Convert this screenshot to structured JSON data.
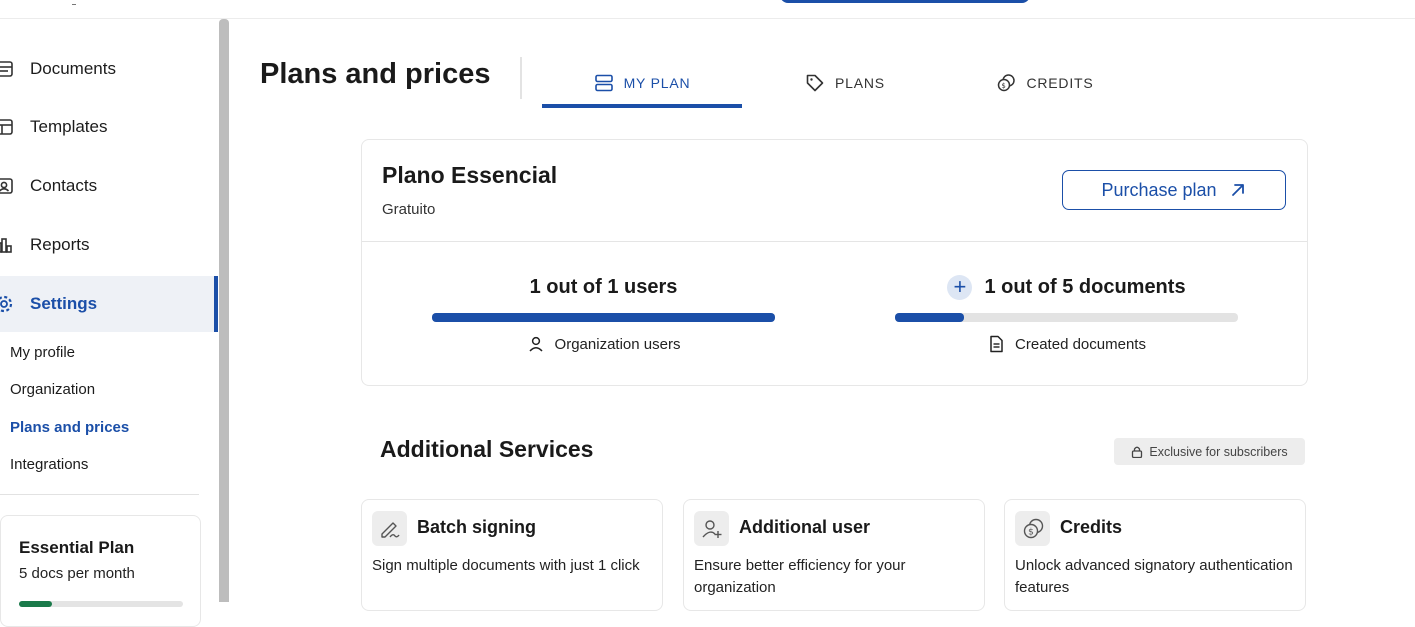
{
  "sidebar": {
    "nav": [
      {
        "label": "Documents",
        "icon": "documents-icon"
      },
      {
        "label": "Templates",
        "icon": "templates-icon"
      },
      {
        "label": "Contacts",
        "icon": "contacts-icon"
      },
      {
        "label": "Reports",
        "icon": "reports-icon"
      },
      {
        "label": "Settings",
        "icon": "gear-icon"
      }
    ],
    "settings_sub": [
      "My profile",
      "Organization",
      "Plans and prices",
      "Integrations"
    ],
    "plan_card": {
      "title": "Essential Plan",
      "subtitle": "5 docs per month",
      "progress": 0.2
    }
  },
  "header": {
    "title": "Plans and prices",
    "tabs": [
      {
        "label": "MY PLAN",
        "icon": "server-icon",
        "active": true
      },
      {
        "label": "PLANS",
        "icon": "tag-icon",
        "active": false
      },
      {
        "label": "CREDITS",
        "icon": "coins-icon",
        "active": false
      }
    ]
  },
  "plan": {
    "name": "Plano Essencial",
    "price": "Gratuito",
    "purchase_label": "Purchase plan",
    "users": {
      "headline": "1 out of 1 users",
      "caption": "Organization users",
      "used": 1,
      "total": 1
    },
    "documents": {
      "headline": "1 out of 5 documents",
      "caption": "Created documents",
      "used": 1,
      "total": 5
    }
  },
  "services": {
    "title": "Additional Services",
    "badge": "Exclusive for subscribers",
    "items": [
      {
        "name": "Batch signing",
        "desc": "Sign multiple documents with just 1 click",
        "icon": "signature-icon"
      },
      {
        "name": "Additional user",
        "desc": "Ensure better efficiency for your organization",
        "icon": "add-user-icon"
      },
      {
        "name": "Credits",
        "desc": "Unlock advanced signatory authentication features",
        "icon": "coins-icon"
      }
    ]
  },
  "colors": {
    "accent": "#1b4fa8",
    "progress_track": "#e3e3e3",
    "badge_bg": "#ededed"
  }
}
